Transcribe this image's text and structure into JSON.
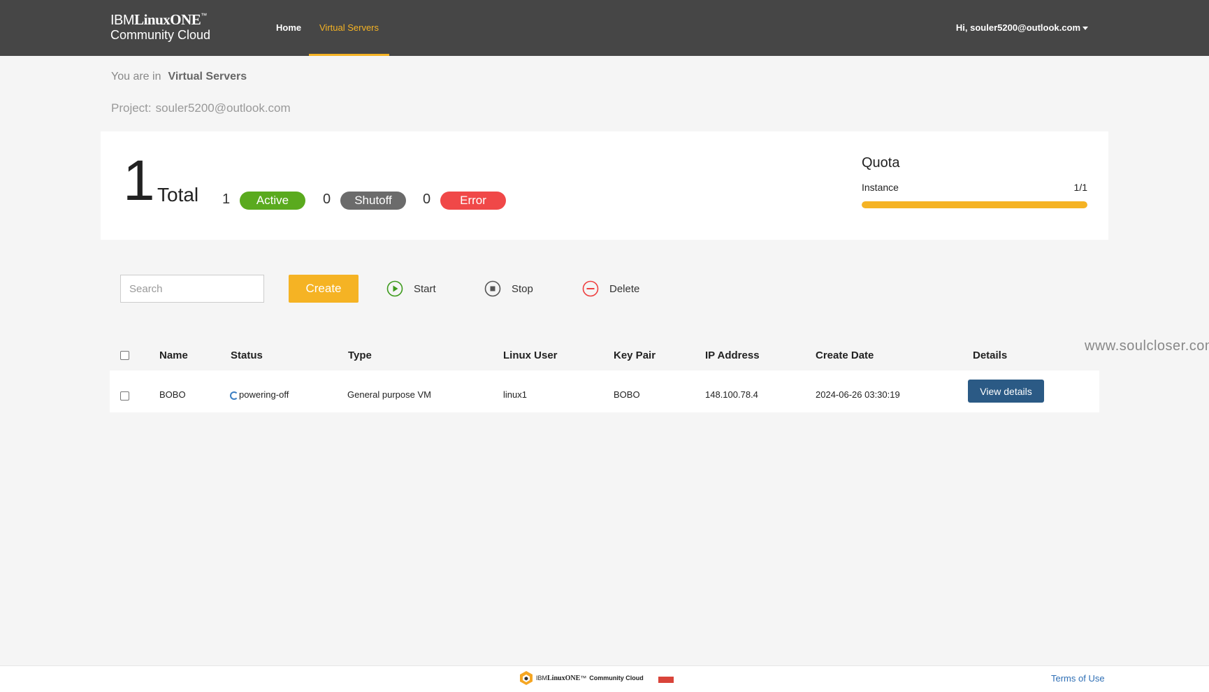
{
  "header": {
    "logo_line1_prefix": "IBM",
    "logo_line1_brand": "LinuxONE",
    "logo_line1_tm": "™",
    "logo_line2": "Community Cloud",
    "nav": [
      {
        "label": "Home"
      },
      {
        "label": "Virtual Servers",
        "active": true
      }
    ],
    "user_greeting": "Hi, souler5200@outlook.com"
  },
  "breadcrumb": {
    "prefix": "You are in",
    "current": "Virtual Servers"
  },
  "project": {
    "label": "Project:",
    "value": "souler5200@outlook.com"
  },
  "summary": {
    "total_count": "1",
    "total_label": "Total",
    "active_count": "1",
    "active_label": "Active",
    "shutoff_count": "0",
    "shutoff_label": "Shutoff",
    "error_count": "0",
    "error_label": "Error",
    "colors": {
      "active": "#5aaa1e",
      "shutoff": "#6b6b6b",
      "error": "#f04848"
    }
  },
  "quota": {
    "title": "Quota",
    "instance_label": "Instance",
    "instance_value": "1/1",
    "used": 1,
    "limit": 1,
    "color": "#f5b324"
  },
  "toolbar": {
    "search_placeholder": "Search",
    "create_label": "Create",
    "start_label": "Start",
    "stop_label": "Stop",
    "delete_label": "Delete",
    "icons": {
      "start": "play-circle-icon",
      "stop": "stop-circle-icon",
      "delete": "minus-circle-icon"
    }
  },
  "watermark": "www.soulcloser.com",
  "table": {
    "headers": {
      "name": "Name",
      "status": "Status",
      "type": "Type",
      "linux_user": "Linux User",
      "key_pair": "Key Pair",
      "ip_address": "IP Address",
      "create_date": "Create Date",
      "details": "Details"
    },
    "rows": [
      {
        "name": "BOBO",
        "status": "powering-off",
        "type": "General purpose VM",
        "linux_user": "linux1",
        "key_pair": "BOBO",
        "ip_address": "148.100.78.4",
        "create_date": "2024-06-26 03:30:19",
        "details_label": "View details"
      }
    ]
  },
  "footer": {
    "logo_prefix": "IBM",
    "logo_brand": "LinuxONE",
    "logo_tm": "™",
    "logo_suffix": "Community Cloud",
    "terms_label": "Terms of Use"
  }
}
